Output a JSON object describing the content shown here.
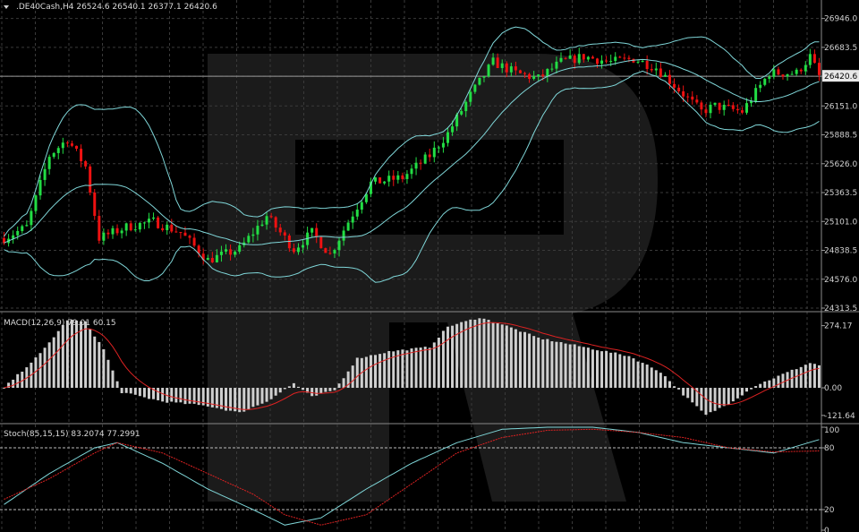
{
  "chart_data": [
    {
      "type": "candlestick",
      "symbol_header": ".DE40Cash,H4  26524.6 26540.1 26377.1 26420.6",
      "last_price_label": "26420.6",
      "ylim": [
        24313.5,
        27000
      ],
      "y_ticks": [
        "26946.0",
        "26683.5",
        "26420.6",
        "26151.0",
        "25888.5",
        "25626.0",
        "25363.5",
        "25101.0",
        "24838.5",
        "24576.0",
        "24313.5"
      ],
      "grid": true,
      "colors": {
        "up": "#22dd44",
        "down": "#ee1111",
        "bands": "#7fd6d8",
        "grid": "#3a3a3a",
        "watermark": "#1b1b1b"
      },
      "anchors": [
        [
          0,
          24950
        ],
        [
          5,
          25050
        ],
        [
          10,
          25700
        ],
        [
          14,
          25850
        ],
        [
          18,
          25600
        ],
        [
          21,
          24950
        ],
        [
          27,
          25050
        ],
        [
          33,
          25100
        ],
        [
          39,
          25000
        ],
        [
          45,
          24750
        ],
        [
          52,
          24850
        ],
        [
          58,
          25150
        ],
        [
          64,
          24850
        ],
        [
          68,
          25000
        ],
        [
          72,
          24800
        ],
        [
          76,
          25100
        ],
        [
          81,
          25450
        ],
        [
          88,
          25500
        ],
        [
          94,
          25700
        ],
        [
          98,
          25900
        ],
        [
          103,
          26250
        ],
        [
          108,
          26550
        ],
        [
          113,
          26450
        ],
        [
          118,
          26400
        ],
        [
          123,
          26550
        ],
        [
          128,
          26600
        ],
        [
          134,
          26550
        ],
        [
          139,
          26580
        ],
        [
          144,
          26500
        ],
        [
          149,
          26300
        ],
        [
          154,
          26100
        ],
        [
          157,
          26150
        ],
        [
          163,
          26100
        ],
        [
          169,
          26450
        ],
        [
          175,
          26450
        ],
        [
          178,
          26600
        ],
        [
          180,
          26420
        ]
      ]
    },
    {
      "type": "bar",
      "name": "MACD(12,26,9) 79.01 60.15",
      "ylim": [
        -150,
        320
      ],
      "y_ticks": [
        "274.17",
        "0.00",
        "-121.64"
      ],
      "colors": {
        "histogram": "#cfcfcf",
        "signal": "#dd2222"
      },
      "anchors": [
        [
          0,
          0
        ],
        [
          8,
          150
        ],
        [
          14,
          300
        ],
        [
          18,
          290
        ],
        [
          22,
          170
        ],
        [
          26,
          -20
        ],
        [
          35,
          -60
        ],
        [
          45,
          -80
        ],
        [
          52,
          -110
        ],
        [
          58,
          -60
        ],
        [
          64,
          20
        ],
        [
          68,
          -40
        ],
        [
          73,
          -10
        ],
        [
          78,
          130
        ],
        [
          85,
          160
        ],
        [
          94,
          180
        ],
        [
          98,
          270
        ],
        [
          105,
          310
        ],
        [
          110,
          280
        ],
        [
          118,
          220
        ],
        [
          128,
          180
        ],
        [
          138,
          140
        ],
        [
          145,
          70
        ],
        [
          150,
          -30
        ],
        [
          155,
          -120
        ],
        [
          160,
          -70
        ],
        [
          166,
          10
        ],
        [
          172,
          60
        ],
        [
          178,
          110
        ],
        [
          180,
          100
        ]
      ]
    },
    {
      "type": "line",
      "name": "Stoch(85,15,15) 83.2074 77.2991",
      "ylim": [
        0,
        100
      ],
      "y_ticks": [
        "100",
        "80",
        "20",
        "0"
      ],
      "levels": [
        80,
        20
      ],
      "colors": {
        "main": "#7fd6d8",
        "signal": "#dd2222"
      },
      "main": [
        [
          0,
          25
        ],
        [
          10,
          55
        ],
        [
          20,
          80
        ],
        [
          25,
          85
        ],
        [
          35,
          65
        ],
        [
          45,
          40
        ],
        [
          55,
          20
        ],
        [
          62,
          5
        ],
        [
          70,
          12
        ],
        [
          80,
          40
        ],
        [
          90,
          65
        ],
        [
          100,
          85
        ],
        [
          110,
          98
        ],
        [
          120,
          100
        ],
        [
          130,
          100
        ],
        [
          140,
          95
        ],
        [
          150,
          85
        ],
        [
          160,
          80
        ],
        [
          170,
          75
        ],
        [
          180,
          88
        ]
      ],
      "signal": [
        [
          0,
          30
        ],
        [
          10,
          50
        ],
        [
          20,
          75
        ],
        [
          25,
          85
        ],
        [
          35,
          75
        ],
        [
          45,
          55
        ],
        [
          55,
          35
        ],
        [
          62,
          15
        ],
        [
          70,
          5
        ],
        [
          80,
          15
        ],
        [
          90,
          45
        ],
        [
          100,
          75
        ],
        [
          110,
          90
        ],
        [
          120,
          97
        ],
        [
          130,
          98
        ],
        [
          140,
          95
        ],
        [
          150,
          90
        ],
        [
          160,
          80
        ],
        [
          170,
          76
        ],
        [
          180,
          77
        ]
      ]
    }
  ]
}
